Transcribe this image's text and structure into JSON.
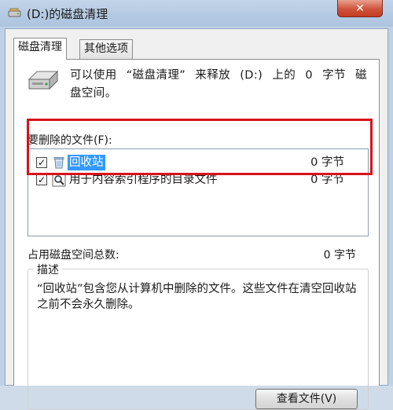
{
  "window": {
    "title": "(D:)的磁盘清理",
    "close_glyph": "✕"
  },
  "tabs": [
    {
      "label": "磁盘清理",
      "active": true
    },
    {
      "label": "其他选项",
      "active": false
    }
  ],
  "intro": {
    "line1_parts": [
      "可以使用",
      "“磁盘清理”",
      "来释放",
      "(D:)",
      "上的",
      "0",
      "字节",
      "磁"
    ],
    "line2": "盘空间。"
  },
  "files_label": "要删除的文件(F):",
  "files": [
    {
      "name": "回收站",
      "size": "0 字节",
      "checked": true,
      "selected": true,
      "icon": "recycle-bin-icon"
    },
    {
      "name": "用于内容索引程序的目录文件",
      "size": "0 字节",
      "checked": true,
      "selected": false,
      "icon": "search-catalog-icon"
    }
  ],
  "checkbox_glyph": "✓",
  "total": {
    "label": "占用磁盘空间总数:",
    "value": "0 字节"
  },
  "description": {
    "legend": "描述",
    "text": "“回收站”包含您从计算机中删除的文件。这些文件在清空回收站之前不会永久删除。"
  },
  "view_files_button": "查看文件(V)",
  "colors": {
    "selection": "#3399ff",
    "annotation_box": "#d8121a",
    "titlebar": "#b4c9e2"
  }
}
